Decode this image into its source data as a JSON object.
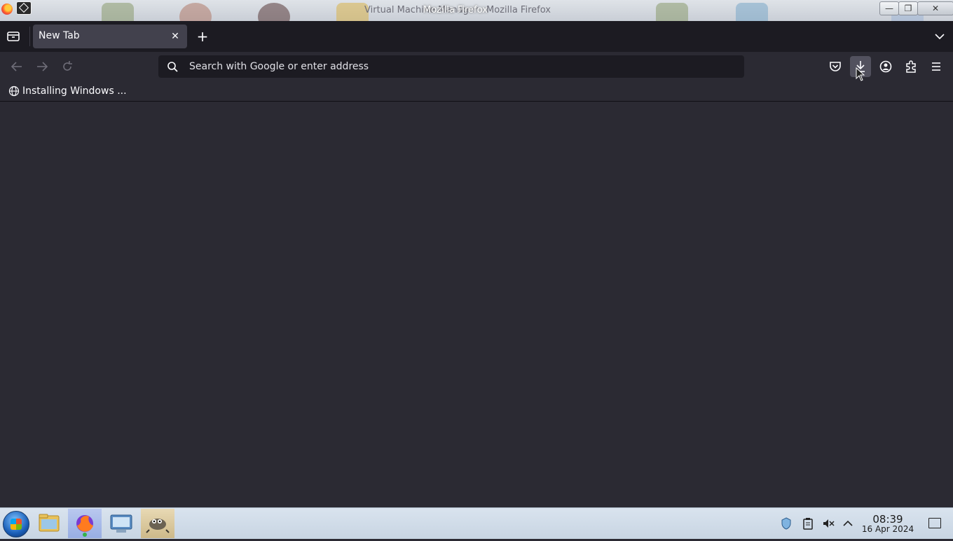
{
  "window": {
    "title": "Mozilla Firefox",
    "ghost_title_left": "Virtual Machine Manager",
    "ghost_title_right": "Mozilla Firefox"
  },
  "window_controls": {
    "minimize": "—",
    "restore": "❐",
    "close": "✕"
  },
  "tabs": [
    {
      "label": "New Tab",
      "close": "✕"
    }
  ],
  "new_tab_label": "+",
  "urlbar": {
    "placeholder": "Search with Google or enter address",
    "value": ""
  },
  "bookmarks": [
    {
      "label": "Installing Windows ...",
      "icon": "globe-icon"
    }
  ],
  "toolbar_icons": [
    "pocket-icon",
    "downloads-icon",
    "account-icon",
    "extensions-icon",
    "menu-icon"
  ],
  "taskbar": {
    "apps": [
      "file-manager-icon",
      "firefox-icon",
      "control-panel-icon",
      "gimp-icon"
    ],
    "tray": [
      "shield-icon",
      "clipboard-icon",
      "volume-muted-icon",
      "chevron-up-icon"
    ],
    "clock": {
      "time": "08:39",
      "date": "16 Apr 2024"
    }
  },
  "colors": {
    "toolbar_bg": "#2b2a33",
    "tabstrip_bg": "#1c1b22",
    "selected_tab": "#42414d",
    "text": "#fbfbfe",
    "taskbar_bg": "#d0dbe7"
  }
}
